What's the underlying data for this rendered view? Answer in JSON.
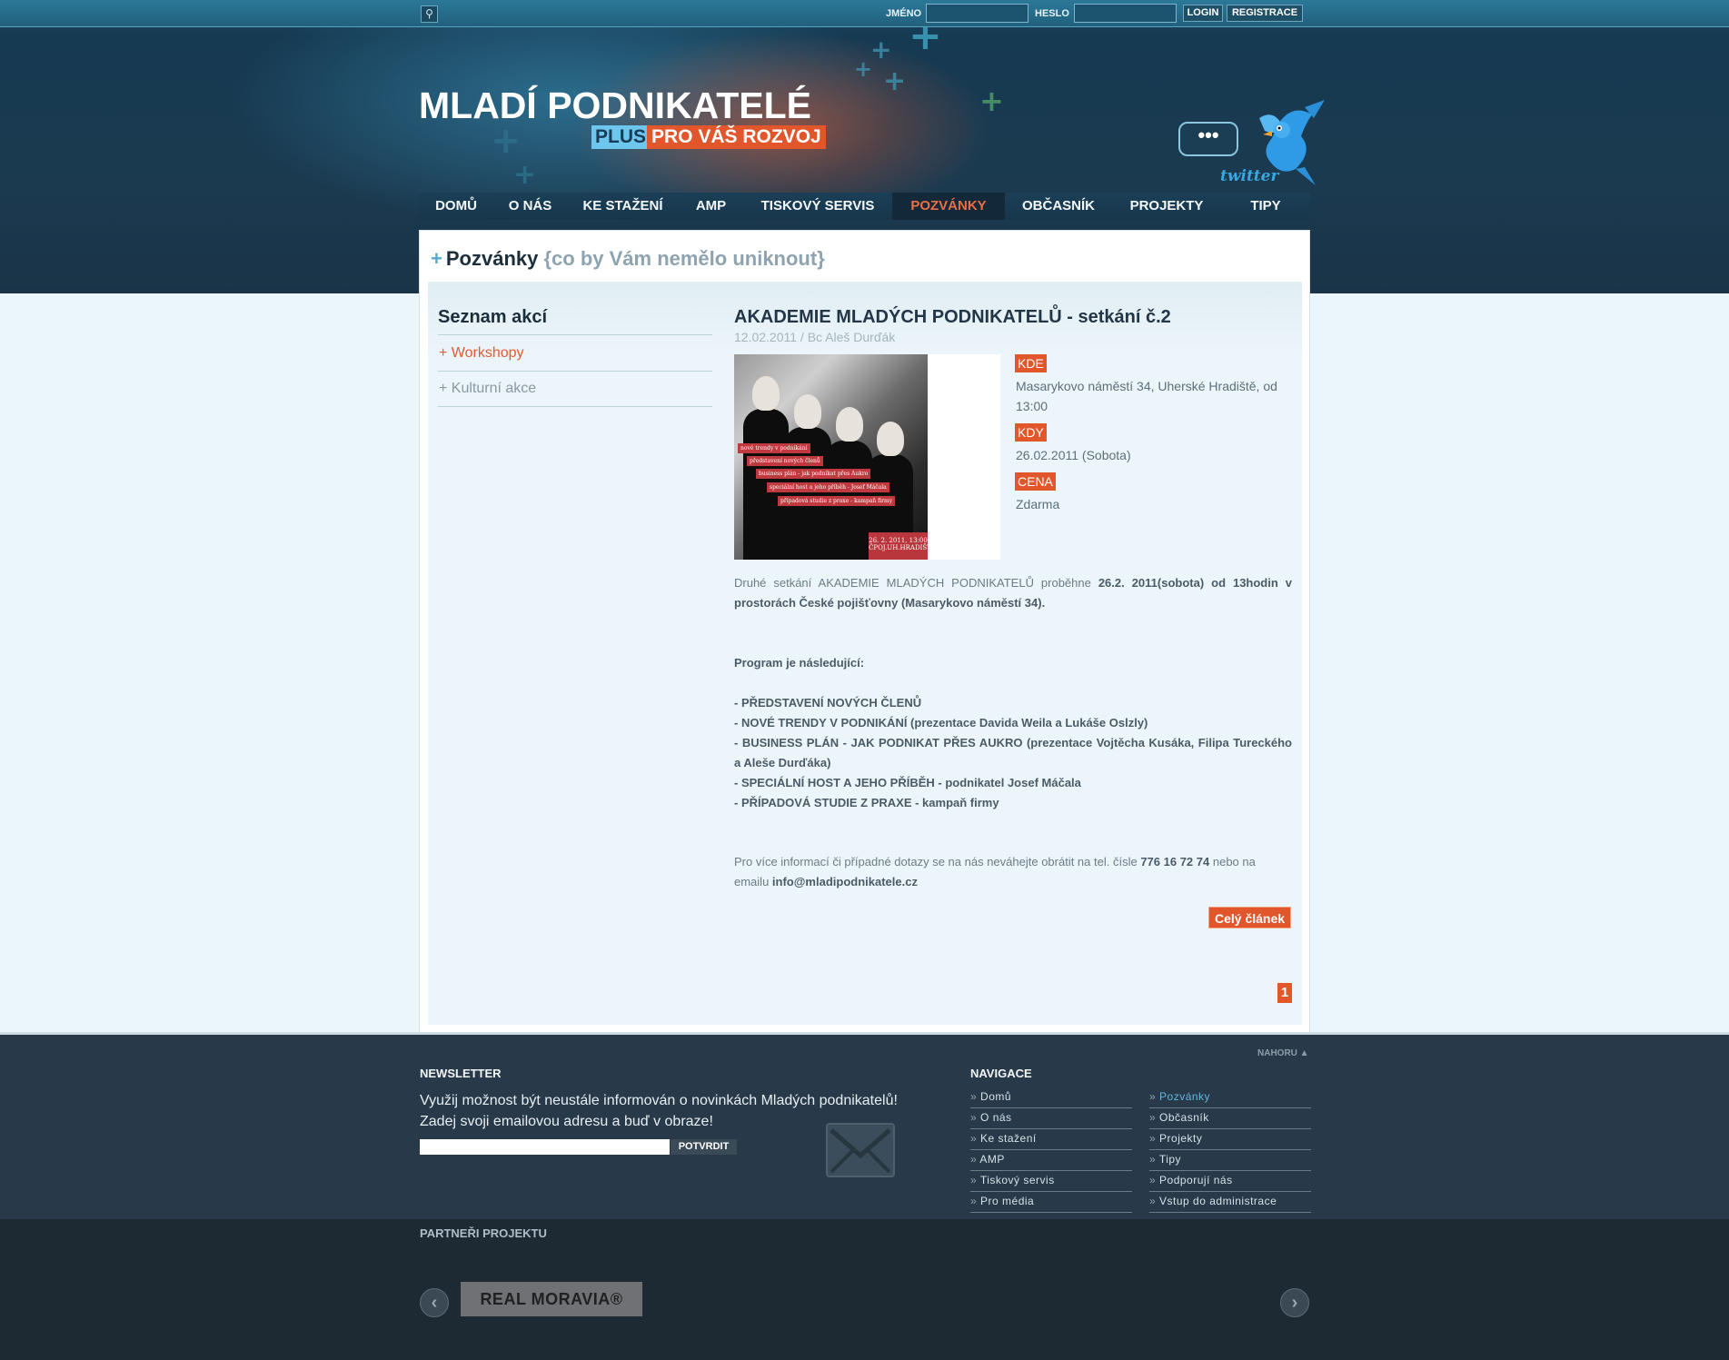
{
  "topbar": {
    "search_icon": "search-icon",
    "name_label": "JMÉNO",
    "name_value": "",
    "password_label": "HESLO",
    "password_value": "",
    "login_label": "LOGIN",
    "register_label": "REGISTRACE"
  },
  "logo": {
    "title": "MLADÍ PODNIKATELÉ",
    "plus": "PLUS",
    "tagline": "PRO VÁŠ ROZVOJ"
  },
  "twitter": {
    "bubble": "•••",
    "word": "twitter",
    "icon": "twitter-bird-icon"
  },
  "nav": [
    {
      "label": "DOMŮ"
    },
    {
      "label": "O NÁS"
    },
    {
      "label": "KE STAŽENÍ"
    },
    {
      "label": "AMP"
    },
    {
      "label": "TISKOVÝ SERVIS"
    },
    {
      "label": "POZVÁNKY"
    },
    {
      "label": "OBČASNÍK"
    },
    {
      "label": "PROJEKTY"
    },
    {
      "label": "TIPY"
    }
  ],
  "section": {
    "plus": "+",
    "title": "Pozvánky",
    "subtitle": "{co by Vám nemělo uniknout}"
  },
  "sidebar": {
    "title": "Seznam akcí",
    "items": [
      {
        "label": "+ Workshopy"
      },
      {
        "label": "+ Kulturní akce"
      }
    ]
  },
  "article": {
    "title": "AKADEMIE MLADÝCH PODNIKATELŮ - setkání č.2",
    "meta": "12.02.2011 / Bc Aleš Durďák",
    "photo_tags": [
      "nové trendy v podnikání",
      "představení nových členů",
      "business plán - jak podnikat přes Aukro",
      "speciální host a jeho příběh - Josef Máčala",
      "případová studie z praxe - kampaň firmy"
    ],
    "photo_date": "26. 2. 2011, 13:00",
    "photo_place": "ČPOJ.UH.HRADIŠTĚ",
    "where_label": "KDE",
    "where_value": "Masarykovo náměstí 34, Uherské Hradiště, od 13:00",
    "when_label": "KDY",
    "when_value": "26.02.2011 (Sobota)",
    "price_label": "CENA",
    "price_value": "Zdarma",
    "intro_1": "Druhé setkání AKADEMIE MLADÝCH PODNIKATELŮ proběhne",
    "intro_bold": "26.2. 2011(sobota) od 13hodin v prostorách České pojišťovny (Masarykovo náměstí 34).",
    "program_heading": "Program je následující:",
    "program": [
      "- PŘEDSTAVENÍ NOVÝCH ČLENŮ",
      "- NOVÉ TRENDY V PODNIKÁNÍ (prezentace Davida Weila a Lukáše Oslzly)",
      "- BUSINESS PLÁN - JAK PODNIKAT PŘES AUKRO (prezentace Vojtěcha Kusáka, Filipa Tureckého a Aleše Durďáka)",
      "- SPECIÁLNÍ HOST A JEHO PŘÍBĚH - podnikatel Josef Máčala",
      "- PŘÍPADOVÁ STUDIE Z PRAXE - kampaň firmy"
    ],
    "contact_1": "Pro více informací či případné dotazy se na nás neváhejte obrátit na tel. čísle",
    "phone": "776 16 72 74",
    "contact_2": "nebo na emailu",
    "email": "info@mladipodnikatele.cz",
    "full_article_label": "Celý článek"
  },
  "pagination": {
    "current": "1"
  },
  "footer": {
    "nahoru": "NAHORU ▲",
    "newsletter_title": "NEWSLETTER",
    "newsletter_line1": "Využij možnost být neustále informován o novinkách Mladých podnikatelů!",
    "newsletter_line2": "Zadej svoji emailovou adresu a buď v obraze!",
    "newsletter_value": "",
    "newsletter_button": "POTVRDIT",
    "envelope_icon": "envelope-icon",
    "nav_title": "NAVIGACE",
    "nav_left": [
      {
        "label": "Domů"
      },
      {
        "label": "O nás"
      },
      {
        "label": "Ke stažení"
      },
      {
        "label": "AMP"
      },
      {
        "label": "Tiskový servis"
      },
      {
        "label": "Pro média"
      }
    ],
    "nav_right": [
      {
        "label": "Pozvánky"
      },
      {
        "label": "Občasník"
      },
      {
        "label": "Projekty"
      },
      {
        "label": "Tipy"
      },
      {
        "label": "Podporují nás"
      },
      {
        "label": "Vstup do administrace"
      }
    ],
    "nav_prefix": "»"
  },
  "partners": {
    "title": "PARTNEŘI PROJEKTU",
    "logo": "REAL MORAVIA®",
    "prev_icon": "chevron-left-icon",
    "next_icon": "chevron-right-icon"
  }
}
